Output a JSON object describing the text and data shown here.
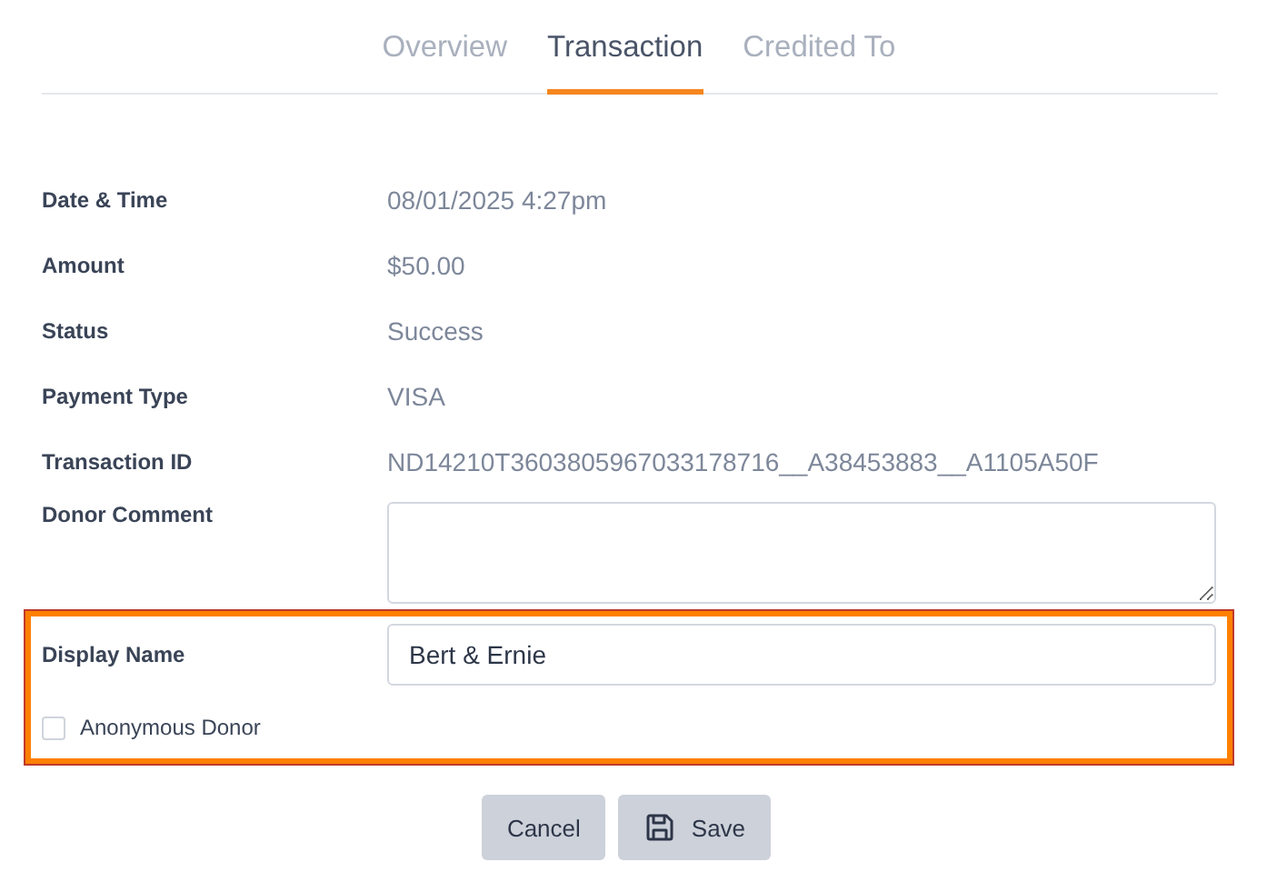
{
  "tabs": [
    {
      "label": "Overview",
      "selected": false
    },
    {
      "label": "Transaction",
      "selected": true
    },
    {
      "label": "Credited To",
      "selected": false
    }
  ],
  "details": [
    {
      "label": "Date & Time",
      "value": "08/01/2025 4:27pm"
    },
    {
      "label": "Amount",
      "value": "$50.00"
    },
    {
      "label": "Status",
      "value": "Success"
    },
    {
      "label": "Payment Type",
      "value": "VISA"
    },
    {
      "label": "Transaction ID",
      "value": "ND14210T3603805967033178716__A38453883__A1105A50F"
    }
  ],
  "donor_comment": {
    "label": "Donor Comment"
  },
  "display_name": {
    "label": "Display Name",
    "value": "Bert & Ernie"
  },
  "anonymous_donor": {
    "label": "Anonymous Donor",
    "checked": false
  },
  "buttons": [
    {
      "kind": "cancel",
      "label": "Cancel"
    },
    {
      "kind": "save",
      "label": "Save"
    }
  ]
}
